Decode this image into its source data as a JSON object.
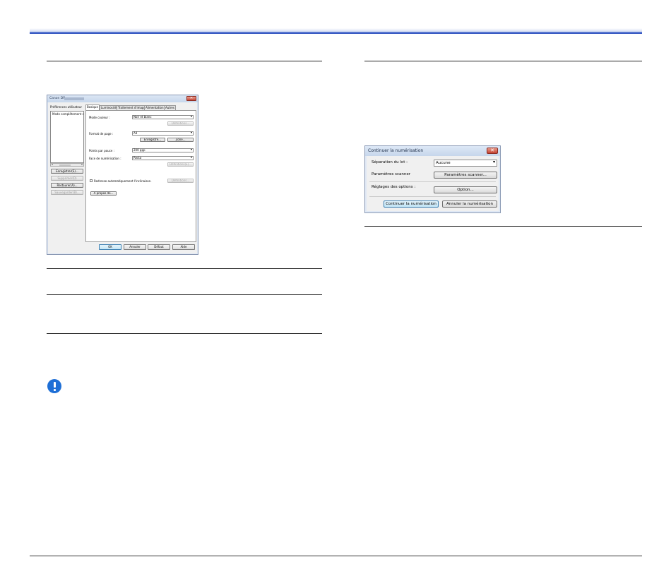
{
  "scanner_settings_dialog": {
    "title": "Canon DR-",
    "close_glyph": "✕",
    "preferences_label": "Préférences utilisateur",
    "preferences_items": [
      "Mode complètement au"
    ],
    "scroll_left": "◂",
    "scroll_right": "▸",
    "side_buttons": [
      "Enregistrer(S)...",
      "Supprimer(D)",
      "Restaurer(A)...",
      "Sauvegarder(B)..."
    ],
    "tabs": [
      "Basique",
      "Luminosité",
      "Traitement d'image",
      "Alimentation",
      "Autres"
    ],
    "fields": {
      "color_mode_label": "Mode couleur :",
      "color_mode_value": "Noir et blanc",
      "definitions_button": "Définitions...",
      "page_size_label": "Format de page :",
      "page_size_value": "A4",
      "register_button": "Enregistre...",
      "zone_button": "Zone...",
      "dpi_label": "Points par pouce :",
      "dpi_value": "200 ppp",
      "scan_side_label": "Face de numérisation :",
      "scan_side_value": "Recto",
      "details_button": "Définitions(E)...",
      "auto_skew_label": "Redresse automatiquement l'inclinaison.",
      "definitions2_button": "Définitions...",
      "about_button": "À propos de..."
    },
    "footer_buttons": [
      "OK",
      "Annuler",
      "Défaut",
      "Aide"
    ]
  },
  "continue_dialog": {
    "title": "Continuer la numérisation",
    "close_glyph": "✕",
    "batch_separation_label": "Séparation du lot :",
    "batch_separation_value": "Aucune",
    "scanner_params_label": "Paramètres scanner",
    "scanner_params_button": "Paramètres scanner...",
    "options_label": "Réglages des options :",
    "options_button": "Option...",
    "continue_button": "Continuer la numérisation",
    "cancel_button": "Annuler la numérisation"
  }
}
